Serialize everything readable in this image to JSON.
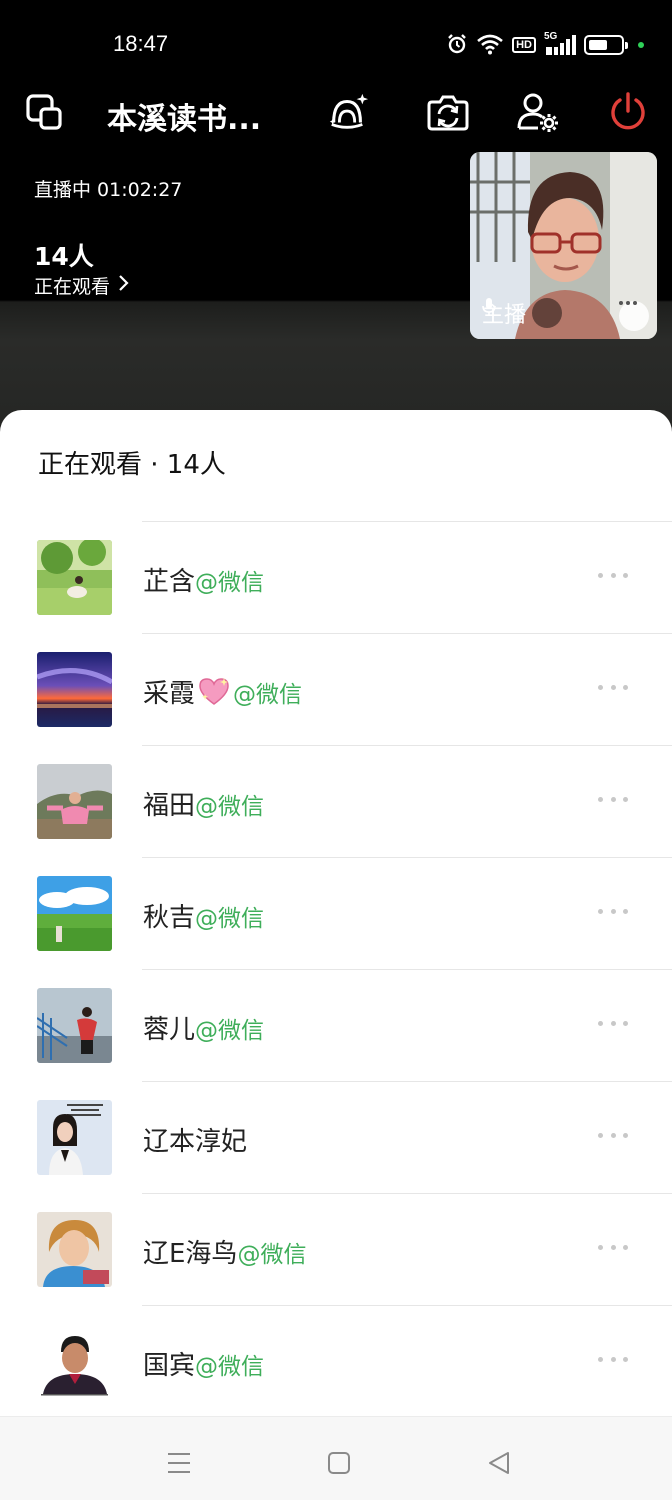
{
  "status_bar": {
    "time": "18:47",
    "hd": "HD",
    "network": "5G",
    "battery_level": 0.55
  },
  "toolbar": {
    "room_title": "本溪读书...",
    "icons": [
      "screen-switch-icon",
      "effects-icon",
      "camera-flip-icon",
      "member-settings-icon",
      "power-icon"
    ],
    "power_color": "#e0403a"
  },
  "live": {
    "status": "直播中 01:02:27",
    "viewer_count": "14人",
    "viewer_link": "正在观看"
  },
  "host": {
    "label": "主播"
  },
  "sheet": {
    "title": "正在观看 · 14人"
  },
  "viewers": [
    {
      "name": "芷含",
      "tag": "@微信"
    },
    {
      "name": "采霞",
      "emoji": "sparkling-heart",
      "tag": "@微信"
    },
    {
      "name": "福田",
      "tag": "@微信"
    },
    {
      "name": "秋吉",
      "tag": "@微信"
    },
    {
      "name": "蓉儿",
      "tag": "@微信"
    },
    {
      "name": "辽本淳妃",
      "tag": ""
    },
    {
      "name": "辽E海鸟",
      "tag": "@微信"
    },
    {
      "name": "国宾",
      "tag": "@微信"
    }
  ],
  "colors": {
    "wechat_green": "#3fae5a",
    "sheet_bg": "#ffffff",
    "live_bg": "#000000"
  }
}
